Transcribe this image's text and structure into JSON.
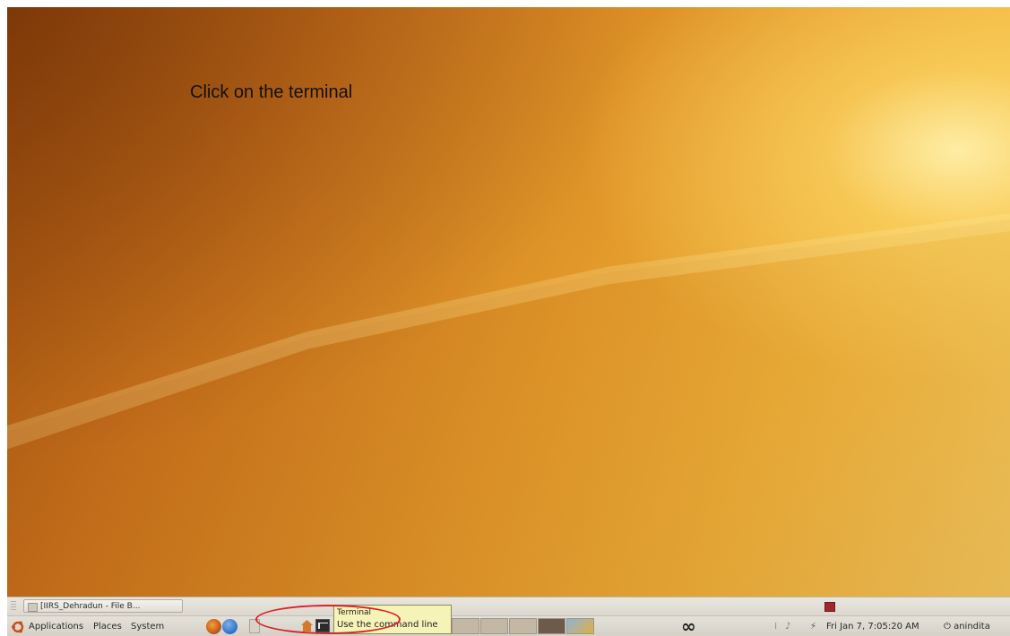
{
  "caption": "Click on the terminal",
  "taskbar": {
    "window_button_label": "[IIRS_Dehradun - File B..."
  },
  "menu": {
    "applications": "Applications",
    "places": "Places",
    "system": "System"
  },
  "tooltip": {
    "title": "Terminal",
    "description": "Use the command line"
  },
  "panel": {
    "infinity_symbol": "∞",
    "clock": "Fri Jan  7,  7:05:20 AM",
    "user": "anindita",
    "tray_icons": [
      "volume-icon",
      "network-icon"
    ]
  },
  "colors": {
    "desktop_base": "#e39a2a",
    "desktop_highlight": "#f6cf62",
    "highlight_ellipse": "#d8232a",
    "tooltip_bg": "#f6f3b8"
  }
}
